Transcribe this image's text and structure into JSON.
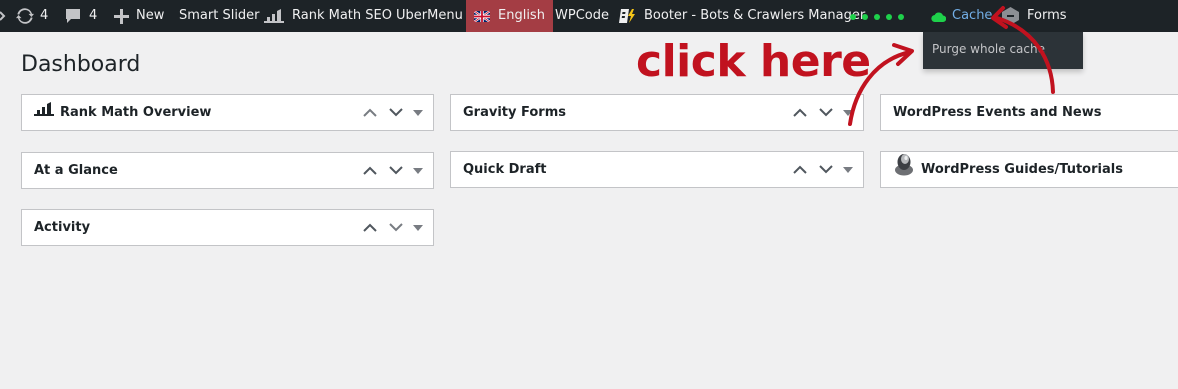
{
  "adminbar": {
    "updates_count": "4",
    "comments_count": "4",
    "new_label": "New",
    "smart_slider_label": "Smart Slider",
    "rank_math_label": "Rank Math SEO",
    "ubermenu_label": "UberMenu",
    "language_label": "English",
    "wpcode_label": "WPCode",
    "booter_label": "Booter - Bots & Crawlers Manager",
    "cache_label": "Cache",
    "forms_label": "Forms",
    "language_bg": "#a43d44",
    "cache_color": "#72aee6",
    "status_dot_color": "#1ed14b"
  },
  "cache_menu": {
    "purge_label": "Purge whole cache"
  },
  "page": {
    "title": "Dashboard"
  },
  "widgets": {
    "rank_math": "Rank Math Overview",
    "at_a_glance": "At a Glance",
    "activity": "Activity",
    "gravity_forms": "Gravity Forms",
    "quick_draft": "Quick Draft",
    "wp_events": "WordPress Events and News",
    "wp_guides": "WordPress Guides/Tutorials"
  },
  "annotation": {
    "text": "click here",
    "color": "#c1121f"
  }
}
